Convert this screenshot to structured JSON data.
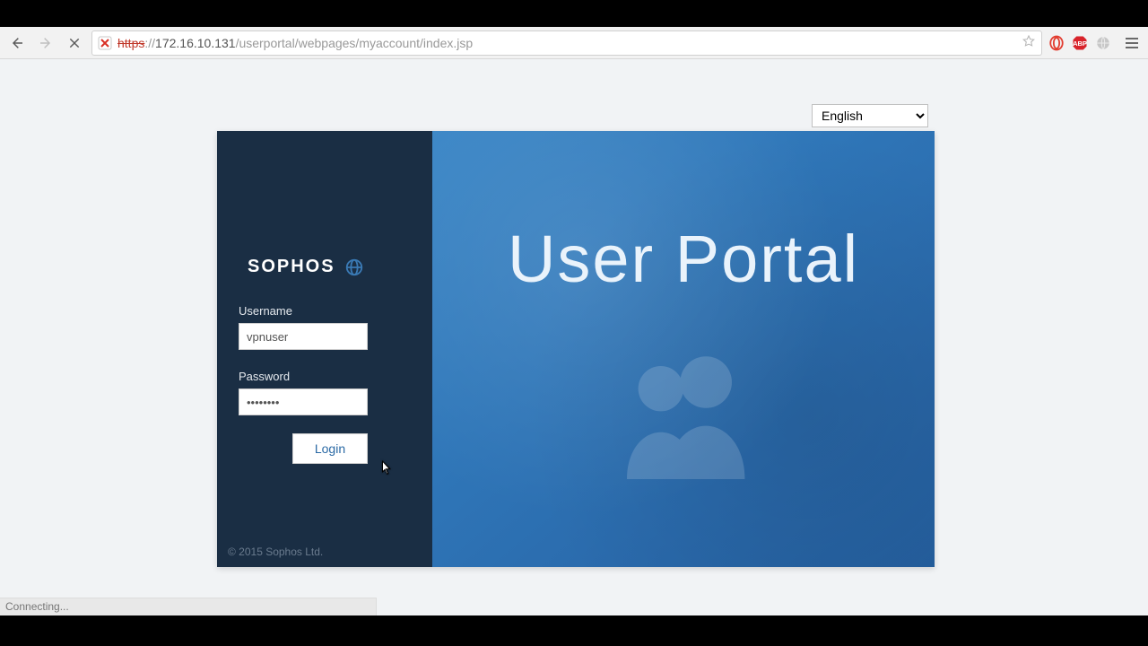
{
  "browser": {
    "url_scheme": "https",
    "url_host": "172.16.10.131",
    "url_path": "/userportal/webpages/myaccount/index.jsp",
    "status": "Connecting..."
  },
  "language": {
    "selected": "English"
  },
  "login": {
    "brand": "SOPHOS",
    "username_label": "Username",
    "username_value": "vpnuser",
    "password_label": "Password",
    "password_value": "••••••••",
    "login_button": "Login",
    "copyright": "© 2015 Sophos Ltd."
  },
  "hero": {
    "title": "User Portal"
  }
}
